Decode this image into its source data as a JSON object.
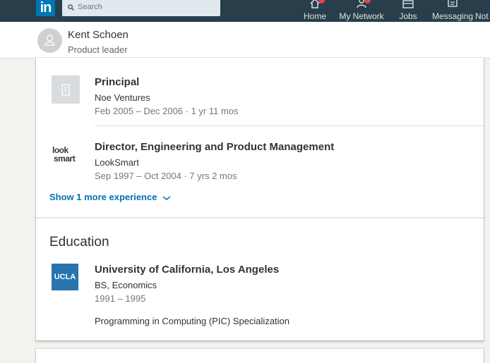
{
  "nav": {
    "search_placeholder": "Search",
    "items": [
      {
        "label": "Home",
        "icon": "home-icon"
      },
      {
        "label": "My Network",
        "icon": "network-icon"
      },
      {
        "label": "Jobs",
        "icon": "jobs-icon"
      },
      {
        "label": "Messaging",
        "icon": "messaging-icon"
      },
      {
        "label": "Not",
        "icon": "notifications-icon"
      }
    ],
    "brand_color": "#0077b5",
    "bar_color": "#283e4a"
  },
  "profile": {
    "name": "Kent Schoen",
    "headline": "Product leader"
  },
  "experience": {
    "entries": [
      {
        "title": "Principal",
        "company": "Noe Ventures",
        "dates": "Feb 2005 – Dec 2006 · 1 yr 11 mos",
        "logo": "building-icon"
      },
      {
        "title": "Director, Engineering and Product Management",
        "company": "LookSmart",
        "dates": "Sep 1997 – Oct 2004 · 7 yrs 2 mos",
        "logo_text_top": "look",
        "logo_text_bottom": "smart"
      }
    ],
    "show_more": "Show 1 more experience"
  },
  "education": {
    "title": "Education",
    "entries": [
      {
        "school": "University of California, Los Angeles",
        "degree": "BS, Economics",
        "dates": "1991 – 1995",
        "note": "Programming in Computing (PIC) Specialization",
        "logo_text": "UCLA",
        "logo_color": "#2774ae"
      }
    ]
  }
}
